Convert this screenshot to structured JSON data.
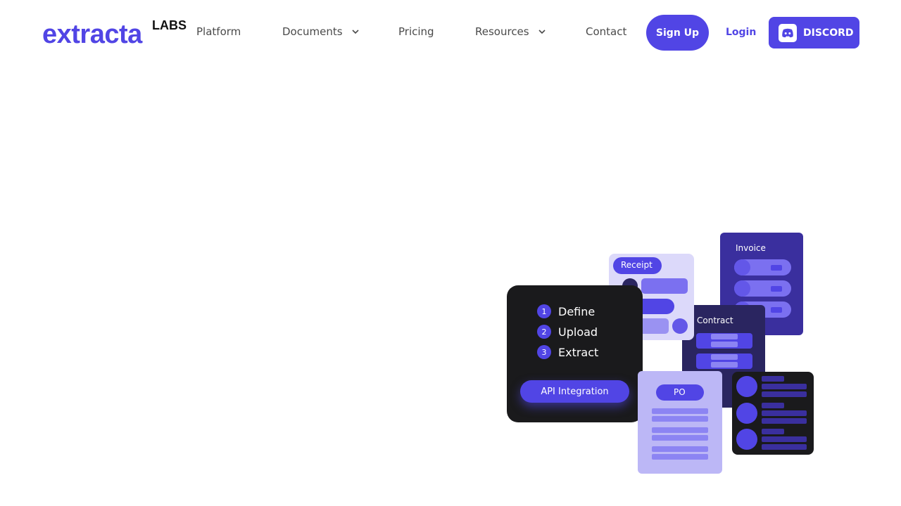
{
  "brand": {
    "name": "extracta",
    "suffix": "LABS",
    "primary_color": "#5145e5"
  },
  "nav": {
    "platform": "Platform",
    "documents": "Documents",
    "pricing": "Pricing",
    "resources": "Resources",
    "contact": "Contact"
  },
  "actions": {
    "signup": "Sign Up",
    "login": "Login",
    "discord": "DISCORD"
  },
  "illustration": {
    "steps": [
      "Define",
      "Upload",
      "Extract"
    ],
    "step_numbers": [
      "1",
      "2",
      "3"
    ],
    "api_button": "API Integration",
    "cards": {
      "receipt": "Receipt",
      "invoice": "Invoice",
      "contract": "Contract",
      "po": "PO"
    }
  },
  "icons": {
    "chevron": "chevron-down-icon",
    "discord": "discord-icon"
  }
}
